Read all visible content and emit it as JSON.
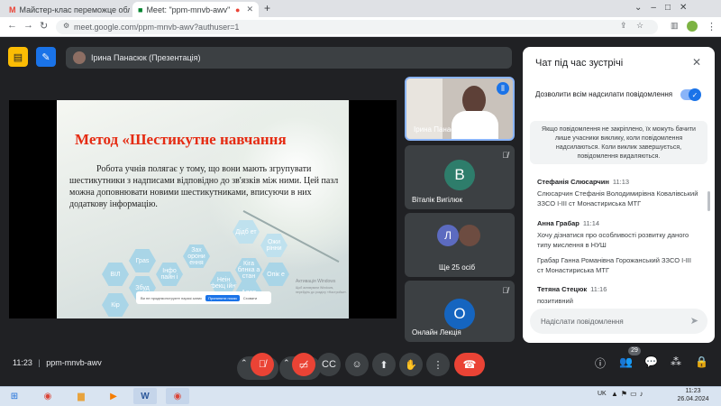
{
  "browser": {
    "tabs": [
      {
        "title": "Майстер-клас переможце обл",
        "icon": "gmail-icon"
      },
      {
        "title": "Meet: \"ppm-mnvb-awv\"",
        "icon": "meet-icon",
        "active": true
      }
    ],
    "url": "meet.google.com/ppm-mnvb-awv?authuser=1"
  },
  "meet": {
    "presenter_label": "Ірина Панасюк (Презентація)",
    "slide": {
      "title": "Метод «Шестикутне навчання",
      "body": "Робота учнів полягає у тому, що вони мають згрупувати шестикутники з надписами відповідно до зв'язків між ними. Цей пазл можна доповнювати новими шестикутниками, вписуючи в них додаткову інформацію.",
      "hexes": [
        {
          "label": "Дідб ет"
        },
        {
          "label": "Ожи рінни"
        },
        {
          "label": "Зах орони ення"
        },
        {
          "label": "Граs"
        },
        {
          "label": "Інфо пайн і"
        },
        {
          "label": "Кіга блнка а стан"
        },
        {
          "label": "ВІЛ"
        },
        {
          "label": "Неін фекц ійні"
        },
        {
          "label": "Опік е"
        },
        {
          "label": "Збуд"
        },
        {
          "label": "Алер"
        },
        {
          "label": "Кір"
        }
      ],
      "activation_text": "Активація Windows",
      "activation_sub": "Щоб активувати Windows, перейдіть до розділу «Настройки».",
      "popup_text": "Ви не продемонструєте наразі запис",
      "popup_btn": "Припинити показ",
      "popup_btn2": "Сховати"
    },
    "participants": [
      {
        "name": "Ірина Панасюк",
        "type": "video"
      },
      {
        "name": "Віталік Вигілюк",
        "initial": "В",
        "color": "#0f9d58"
      },
      {
        "name": "Ще 25 осіб",
        "initial": "Л",
        "color": "#5c6bc0"
      },
      {
        "name": "Онлайн Лекція",
        "initial": "О",
        "color": "#1565c0"
      }
    ],
    "meeting_time": "11:23",
    "meeting_code": "ppm-mnvb-awv",
    "people_count": "29"
  },
  "chat": {
    "title": "Чат під час зустрічі",
    "toggle_label": "Дозволити всім надсилати повідомлення",
    "info": "Якщо повідомлення не закріплено, їх можуть бачити лише учасники виклику, коли повідомлення надсилаються. Коли виклик завершується, повідомлення видаляються.",
    "messages": [
      {
        "author": "Стефанія Слюсарчин",
        "time": "11:13",
        "text": "Слюсарчин Стефанія Володимирівна Ковалівський ЗЗСО І-ІІІ ст Монастириська МТГ"
      },
      {
        "author": "Анна Грабар",
        "time": "11:14",
        "text": "Хочу дізнатися про особливості розвитку даного типу мислення в НУШ"
      },
      {
        "author": "",
        "time": "",
        "text": "Грабар Ганна Романівна Горожанський ЗЗСО І-ІІІ ст Монастириська МТГ"
      },
      {
        "author": "Тетяна Стецюк",
        "time": "11:16",
        "text": "позитивний"
      }
    ],
    "input_placeholder": "Надіслати повідомлення"
  },
  "taskbar": {
    "time": "11:23",
    "date": "26.04.2024",
    "lang": "UK"
  }
}
